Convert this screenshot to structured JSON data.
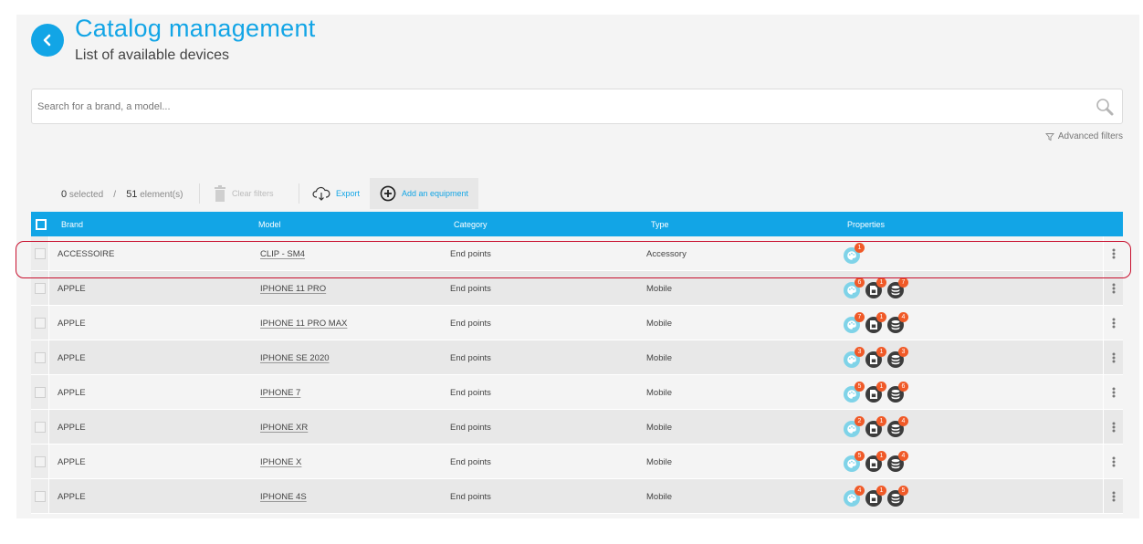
{
  "header": {
    "title": "Catalog management",
    "subtitle": "List of available devices"
  },
  "search": {
    "placeholder": "Search for a brand, a model..."
  },
  "filters": {
    "advanced_label": "Advanced filters"
  },
  "toolbar": {
    "selected_count": "0",
    "selected_label": "selected",
    "separator": "/",
    "element_count": "51",
    "element_label": "element(s)",
    "clear_filters": "Clear filters",
    "export": "Export",
    "add_equipment": "Add an equipment"
  },
  "table": {
    "columns": [
      "Brand",
      "Model",
      "Category",
      "Type",
      "Properties"
    ],
    "rows": [
      {
        "brand": "ACCESSOIRE",
        "model": "CLIP - SM4",
        "category": "End points",
        "type": "Accessory",
        "badges": [
          "1"
        ]
      },
      {
        "brand": "APPLE",
        "model": "IPHONE 11 PRO",
        "category": "End points",
        "type": "Mobile",
        "badges": [
          "6",
          "1",
          "7"
        ]
      },
      {
        "brand": "APPLE",
        "model": "IPHONE 11 PRO MAX",
        "category": "End points",
        "type": "Mobile",
        "badges": [
          "7",
          "1",
          "4"
        ]
      },
      {
        "brand": "APPLE",
        "model": "IPHONE SE 2020",
        "category": "End points",
        "type": "Mobile",
        "badges": [
          "3",
          "1",
          "3"
        ]
      },
      {
        "brand": "APPLE",
        "model": "IPHONE 7",
        "category": "End points",
        "type": "Mobile",
        "badges": [
          "5",
          "1",
          "6"
        ]
      },
      {
        "brand": "APPLE",
        "model": "IPHONE XR",
        "category": "End points",
        "type": "Mobile",
        "badges": [
          "2",
          "1",
          "4"
        ]
      },
      {
        "brand": "APPLE",
        "model": "IPHONE X",
        "category": "End points",
        "type": "Mobile",
        "badges": [
          "5",
          "1",
          "4"
        ]
      },
      {
        "brand": "APPLE",
        "model": "IPHONE 4S",
        "category": "End points",
        "type": "Mobile",
        "badges": [
          "4",
          "1",
          "5"
        ]
      }
    ]
  },
  "colors": {
    "accent": "#12a5e6",
    "badge": "#f05a28",
    "highlight": "#c8102e"
  },
  "icons": {
    "back": "chevron-left-icon",
    "search": "search-icon",
    "filter": "filter-icon",
    "trash": "trash-icon",
    "export": "cloud-download-icon",
    "add": "plus-circle-icon",
    "props": [
      "palette-icon",
      "sim-card-icon",
      "storage-icon"
    ],
    "menu": "kebab-menu-icon"
  }
}
